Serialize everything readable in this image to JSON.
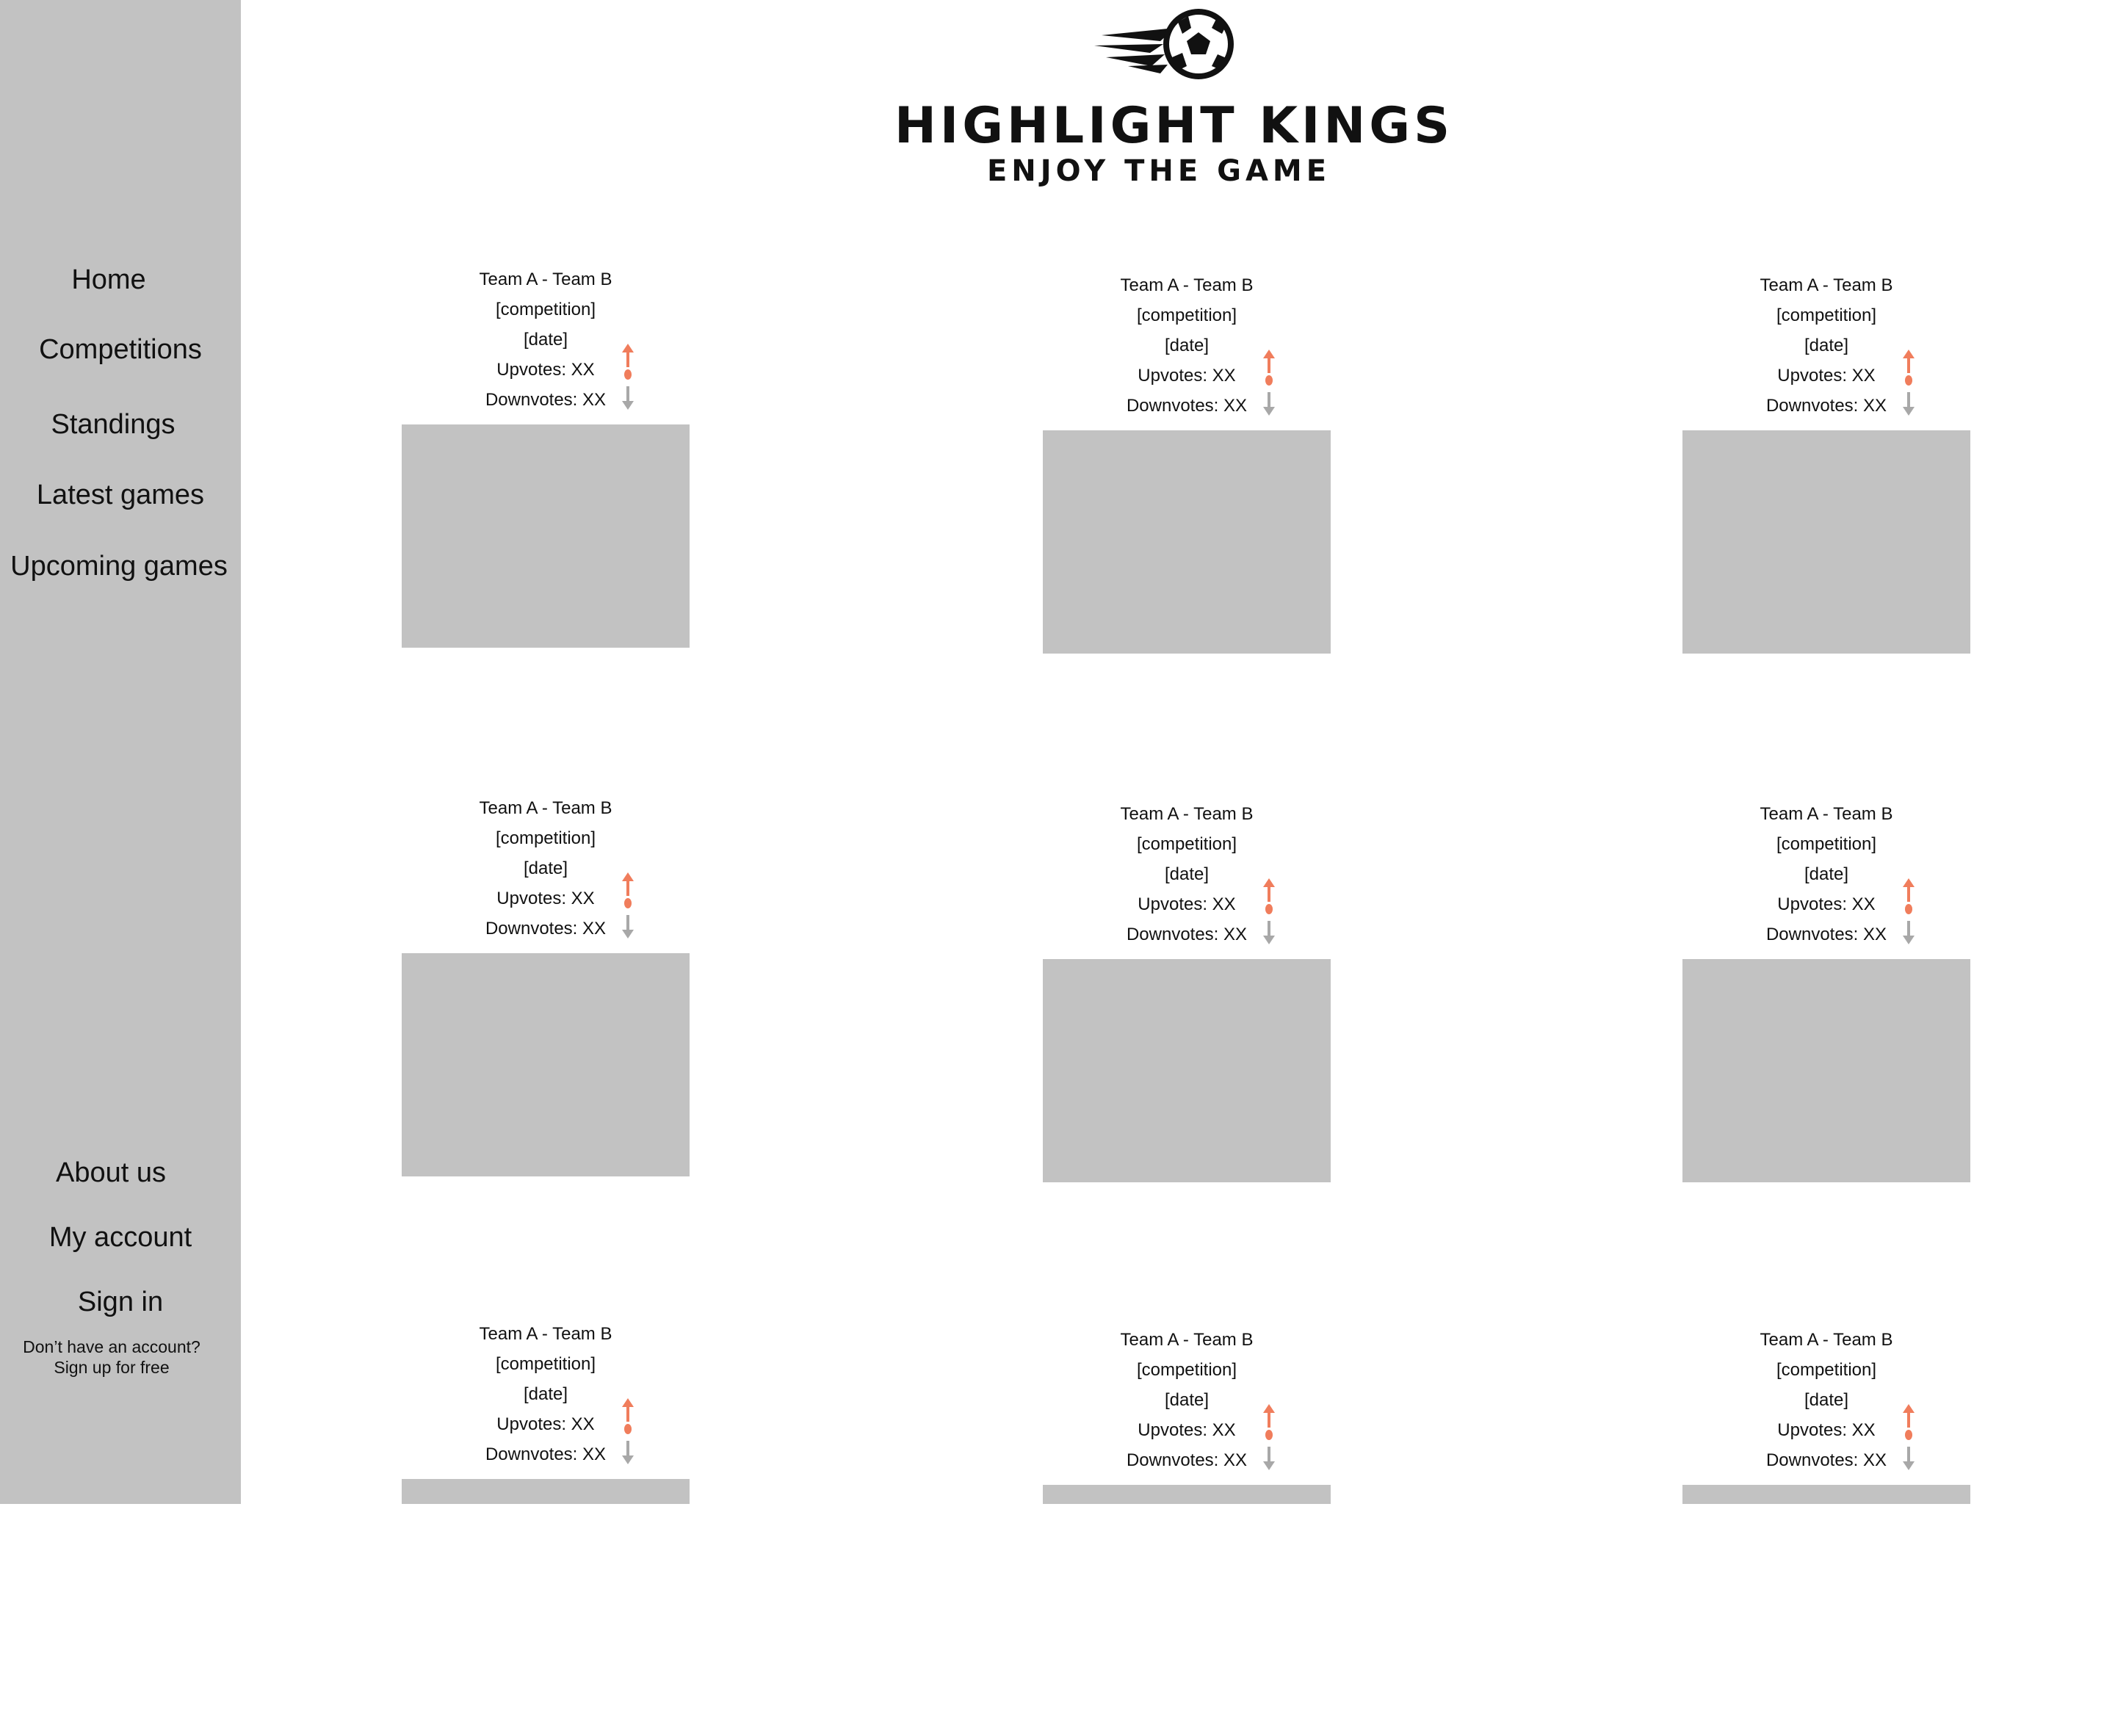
{
  "app": {
    "logo_title": "HIGHLIGHT KINGS",
    "logo_subtitle": "ENJOY THE GAME",
    "accent_color": "#f07d5c",
    "sidebar_color": "#c2c2c2"
  },
  "sidebar": {
    "items": [
      {
        "label": "Home"
      },
      {
        "label": "Competitions"
      },
      {
        "label": "Standings"
      },
      {
        "label": "Latest games"
      },
      {
        "label": "Upcoming games"
      }
    ],
    "footer_items": [
      {
        "label": "About us"
      },
      {
        "label": "My account"
      },
      {
        "label": "Sign in"
      }
    ],
    "signup_prompt": "Don’t have an account?",
    "signup_link": "Sign up for free"
  },
  "games": [
    {
      "teams": "Team A - Team B",
      "competition": "[competition]",
      "date": "[date]",
      "upvotes": "Upvotes: XX",
      "downvotes": "Downvotes: XX"
    },
    {
      "teams": "Team A - Team B",
      "competition": "[competition]",
      "date": "[date]",
      "upvotes": "Upvotes: XX",
      "downvotes": "Downvotes: XX"
    },
    {
      "teams": "Team A - Team B",
      "competition": "[competition]",
      "date": "[date]",
      "upvotes": "Upvotes: XX",
      "downvotes": "Downvotes: XX"
    },
    {
      "teams": "Team A - Team B",
      "competition": "[competition]",
      "date": "[date]",
      "upvotes": "Upvotes: XX",
      "downvotes": "Downvotes: XX"
    },
    {
      "teams": "Team A - Team B",
      "competition": "[competition]",
      "date": "[date]",
      "upvotes": "Upvotes: XX",
      "downvotes": "Downvotes: XX"
    },
    {
      "teams": "Team A - Team B",
      "competition": "[competition]",
      "date": "[date]",
      "upvotes": "Upvotes: XX",
      "downvotes": "Downvotes: XX"
    },
    {
      "teams": "Team A - Team B",
      "competition": "[competition]",
      "date": "[date]",
      "upvotes": "Upvotes: XX",
      "downvotes": "Downvotes: XX"
    },
    {
      "teams": "Team A - Team B",
      "competition": "[competition]",
      "date": "[date]",
      "upvotes": "Upvotes: XX",
      "downvotes": "Downvotes: XX"
    },
    {
      "teams": "Team A - Team B",
      "competition": "[competition]",
      "date": "[date]",
      "upvotes": "Upvotes: XX",
      "downvotes": "Downvotes: XX"
    }
  ]
}
